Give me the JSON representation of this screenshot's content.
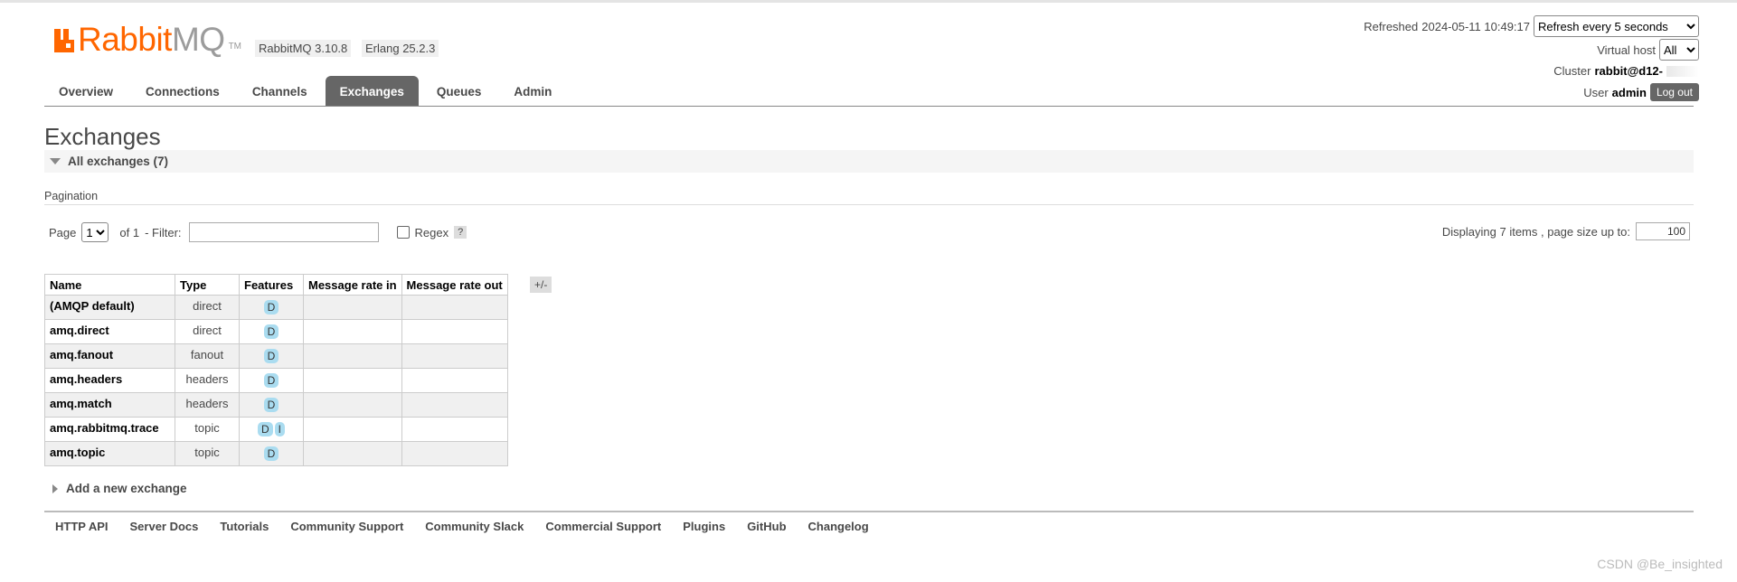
{
  "app": {
    "logo_rabbit": "Rabbit",
    "logo_mq": "MQ",
    "logo_tm": "TM",
    "version": "RabbitMQ 3.10.8",
    "erlang": "Erlang 25.2.3"
  },
  "header": {
    "refreshed_label": "Refreshed",
    "refreshed_time": "2024-05-11 10:49:17",
    "refresh_select": "Refresh every 5 seconds",
    "vhost_label": "Virtual host",
    "vhost_select": "All",
    "cluster_label": "Cluster",
    "cluster_value": "rabbit@d12-",
    "user_label": "User",
    "user_value": "admin",
    "logout_label": "Log out"
  },
  "nav": {
    "overview": "Overview",
    "connections": "Connections",
    "channels": "Channels",
    "exchanges": "Exchanges",
    "queues": "Queues",
    "admin": "Admin"
  },
  "page": {
    "title": "Exchanges",
    "section_title": "All exchanges (7)"
  },
  "pagination": {
    "label": "Pagination",
    "page_label": "Page",
    "page_value": "1",
    "of_label": "of 1",
    "filter_label": "- Filter:",
    "filter_value": "",
    "regex_label": "Regex",
    "help_label": "?",
    "display_text": "Displaying 7 items , page size up to:",
    "page_size": "100"
  },
  "table": {
    "headers": {
      "name": "Name",
      "type": "Type",
      "features": "Features",
      "rate_in": "Message rate in",
      "rate_out": "Message rate out"
    },
    "toggle_label": "+/-",
    "rows": [
      {
        "name": "(AMQP default)",
        "type": "direct",
        "f1": "D",
        "f2": ""
      },
      {
        "name": "amq.direct",
        "type": "direct",
        "f1": "D",
        "f2": ""
      },
      {
        "name": "amq.fanout",
        "type": "fanout",
        "f1": "D",
        "f2": ""
      },
      {
        "name": "amq.headers",
        "type": "headers",
        "f1": "D",
        "f2": ""
      },
      {
        "name": "amq.match",
        "type": "headers",
        "f1": "D",
        "f2": ""
      },
      {
        "name": "amq.rabbitmq.trace",
        "type": "topic",
        "f1": "D",
        "f2": "I"
      },
      {
        "name": "amq.topic",
        "type": "topic",
        "f1": "D",
        "f2": ""
      }
    ]
  },
  "add_exchange": {
    "title": "Add a new exchange"
  },
  "footer": {
    "http_api": "HTTP API",
    "server_docs": "Server Docs",
    "tutorials": "Tutorials",
    "community_support": "Community Support",
    "community_slack": "Community Slack",
    "commercial_support": "Commercial Support",
    "plugins": "Plugins",
    "github": "GitHub",
    "changelog": "Changelog"
  },
  "watermark": "CSDN @Be_insighted",
  "colors": {
    "brand": "#ff6600",
    "active_tab": "#666666",
    "feature_badge": "#aadcf0"
  }
}
